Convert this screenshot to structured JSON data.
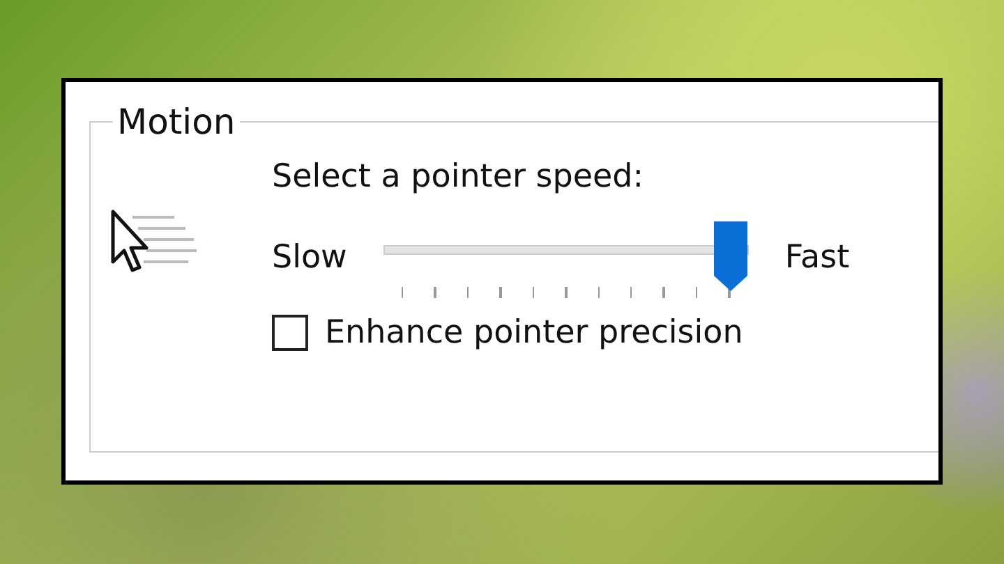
{
  "group": {
    "title": "Motion"
  },
  "speed": {
    "label": "Select a pointer speed:",
    "min_label": "Slow",
    "max_label": "Fast",
    "level": 1.0
  },
  "precision": {
    "label": "Enhance pointer precision",
    "checked": false
  }
}
